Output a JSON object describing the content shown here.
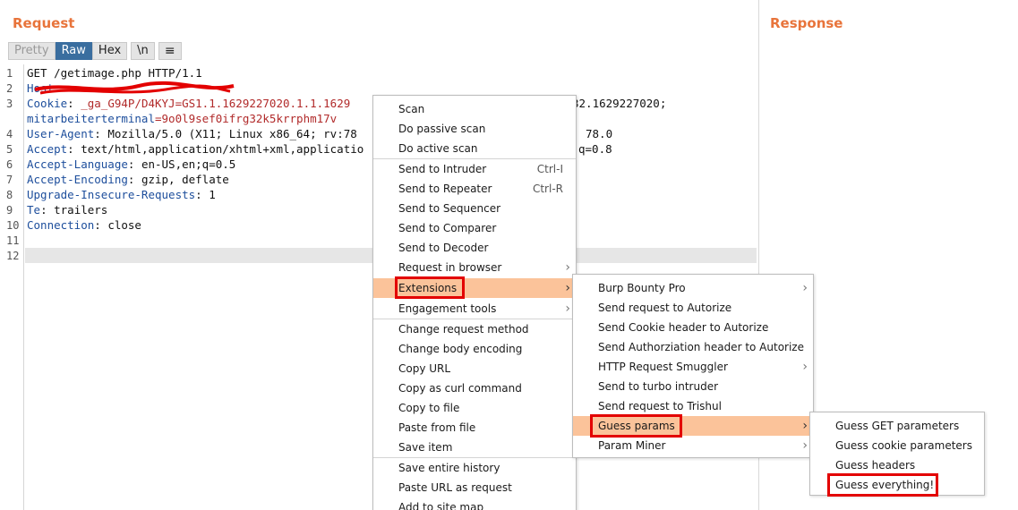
{
  "request": {
    "title": "Request",
    "tabs": [
      "Pretty",
      "Raw",
      "Hex"
    ],
    "newline_label": "\\n",
    "menu_label": "≡",
    "line_numbers": [
      "1",
      "2",
      "3",
      "4",
      "5",
      "6",
      "7",
      "8",
      "9",
      "10",
      "11",
      "12"
    ],
    "lines": {
      "l1": "GET /getimage.php HTTP/1.1",
      "l2_key": "Host",
      "l2_sep": ": ",
      "l3_key": "Cookie",
      "l3_sep": ": ",
      "l3_val": "_ga_G94P/D4KYJ=GS1.1.1629227020.1.1.1629",
      "l3_tail": "32.1629227020;",
      "l3b_key": "mitarbeiterterminal",
      "l3b_val": "=9o0l9sef0ifrg32k5krrphm17v",
      "l4_key": "User-Agent",
      "l4_val": ": Mozilla/5.0 (X11; Linux x86_64; rv:78",
      "l4_tail": "78.0",
      "l5_key": "Accept",
      "l5_val": ": text/html,application/xhtml+xml,applicatio",
      "l5_tail": "q=0.8",
      "l6_key": "Accept-Language",
      "l6_val": ": en-US,en;q=0.5",
      "l7_key": "Accept-Encoding",
      "l7_val": ": gzip, deflate",
      "l8_key": "Upgrade-Insecure-Requests",
      "l8_val": ": 1",
      "l9_key": "Te",
      "l9_val": ": trailers",
      "l10_key": "Connection",
      "l10_val": ": close"
    }
  },
  "response": {
    "title": "Response"
  },
  "context_menu": {
    "scan": "Scan",
    "passive": "Do passive scan",
    "active": "Do active scan",
    "intruder": "Send to Intruder",
    "intruder_sc": "Ctrl-I",
    "repeater": "Send to Repeater",
    "repeater_sc": "Ctrl-R",
    "sequencer": "Send to Sequencer",
    "comparer": "Send to Comparer",
    "decoder": "Send to Decoder",
    "browser": "Request in browser",
    "extensions": "Extensions",
    "engagement": "Engagement tools",
    "change_method": "Change request method",
    "change_encoding": "Change body encoding",
    "copy_url": "Copy URL",
    "copy_curl": "Copy as curl command",
    "copy_file": "Copy to file",
    "paste_file": "Paste from file",
    "save_item": "Save item",
    "save_history": "Save entire history",
    "paste_url": "Paste URL as request",
    "add_sitemap": "Add to site map"
  },
  "extensions_menu": {
    "burp_bounty": "Burp Bounty Pro",
    "autorize_req": "Send request to Autorize",
    "autorize_cookie": "Send Cookie header to Autorize",
    "autorize_auth": "Send Authorziation header to Autorize",
    "smuggler": "HTTP Request Smuggler",
    "turbo": "Send to turbo intruder",
    "trishul": "Send request to Trishul",
    "guess_params": "Guess params",
    "param_miner": "Param Miner"
  },
  "guess_menu": {
    "get": "Guess GET parameters",
    "cookie": "Guess cookie parameters",
    "headers": "Guess headers",
    "everything": "Guess everything!"
  },
  "colors": {
    "accent": "#e8743b",
    "highlight": "#fbc39a",
    "annotation": "#e30000",
    "active_tab": "#3a6e9f"
  },
  "icons": {
    "submenu": "chevron-right-icon",
    "menu": "hamburger-icon"
  }
}
